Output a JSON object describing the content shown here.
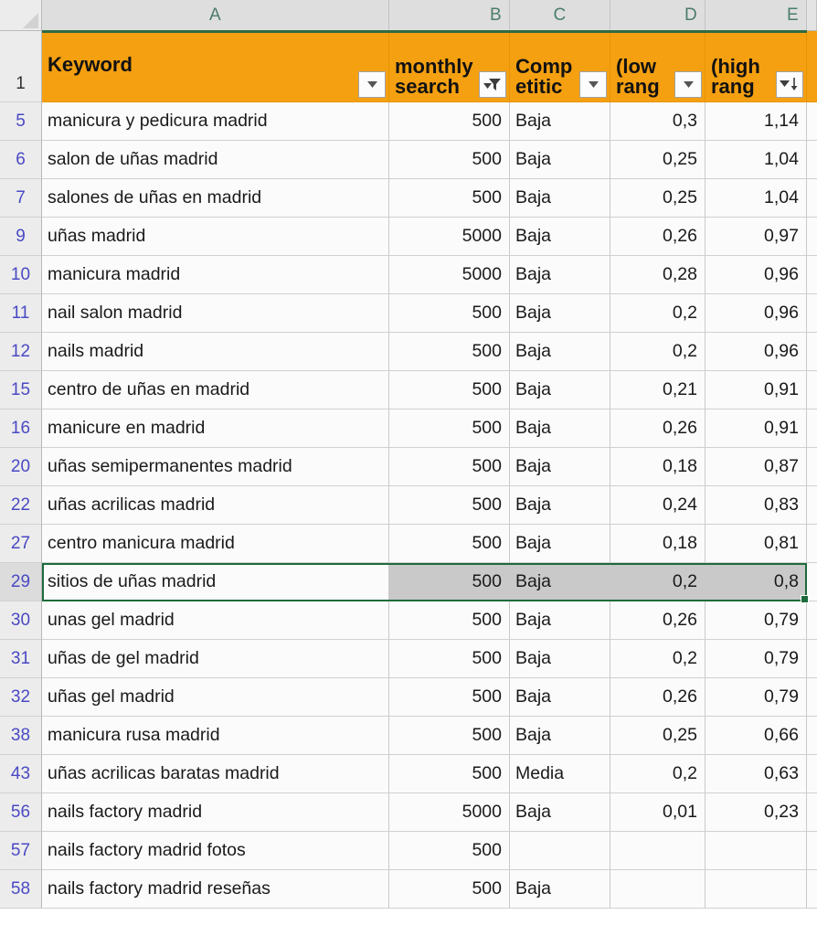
{
  "app": {
    "type": "spreadsheet",
    "accent_orange": "#F5A011",
    "selection_green": "#1D6B3C",
    "rowheader_blue": "#4A49C4",
    "colheader_teal": "#4B7D69",
    "selected_fill_gray": "#C9C9C9"
  },
  "column_headers": {
    "corner": "select-all",
    "letters": [
      "A",
      "B",
      "C",
      "D",
      "E"
    ]
  },
  "filter_header": {
    "row_number": "1",
    "cells": [
      {
        "col": "A",
        "text": "Keyword",
        "icon": "filter-dropdown-icon",
        "filtered": false,
        "sorted": "none"
      },
      {
        "col": "B",
        "text": "monthly\nsearch",
        "icon": "filter-applied-icon",
        "filtered": true,
        "sorted": "none"
      },
      {
        "col": "C",
        "text": "Comp\netitic",
        "icon": "filter-dropdown-icon",
        "filtered": false,
        "sorted": "none"
      },
      {
        "col": "D",
        "text": "(low\nrang",
        "icon": "filter-dropdown-icon",
        "filtered": false,
        "sorted": "none"
      },
      {
        "col": "E",
        "text": "(high\nrang",
        "icon": "sort-descending-icon",
        "filtered": false,
        "sorted": "descending"
      }
    ]
  },
  "selection": {
    "active_cell_row": "29",
    "active_cell_text": "sitios de uñas madrid",
    "range": "A29:E29",
    "fill_handle": true
  },
  "table": {
    "columns": [
      "Keyword",
      "monthly search",
      "Competition",
      "(low range)",
      "(high range)"
    ],
    "rows": [
      {
        "n": "5",
        "keyword": "manicura y pedicura madrid",
        "searches": "500",
        "competition": "Baja",
        "low": "0,3",
        "high": "1,14",
        "selected": false
      },
      {
        "n": "6",
        "keyword": "salon de uñas madrid",
        "searches": "500",
        "competition": "Baja",
        "low": "0,25",
        "high": "1,04",
        "selected": false
      },
      {
        "n": "7",
        "keyword": "salones de uñas en madrid",
        "searches": "500",
        "competition": "Baja",
        "low": "0,25",
        "high": "1,04",
        "selected": false
      },
      {
        "n": "9",
        "keyword": "uñas madrid",
        "searches": "5000",
        "competition": "Baja",
        "low": "0,26",
        "high": "0,97",
        "selected": false
      },
      {
        "n": "10",
        "keyword": "manicura madrid",
        "searches": "5000",
        "competition": "Baja",
        "low": "0,28",
        "high": "0,96",
        "selected": false
      },
      {
        "n": "11",
        "keyword": "nail salon madrid",
        "searches": "500",
        "competition": "Baja",
        "low": "0,2",
        "high": "0,96",
        "selected": false
      },
      {
        "n": "12",
        "keyword": "nails madrid",
        "searches": "500",
        "competition": "Baja",
        "low": "0,2",
        "high": "0,96",
        "selected": false
      },
      {
        "n": "15",
        "keyword": "centro de uñas en madrid",
        "searches": "500",
        "competition": "Baja",
        "low": "0,21",
        "high": "0,91",
        "selected": false
      },
      {
        "n": "16",
        "keyword": "manicure en madrid",
        "searches": "500",
        "competition": "Baja",
        "low": "0,26",
        "high": "0,91",
        "selected": false
      },
      {
        "n": "20",
        "keyword": "uñas semipermanentes madrid",
        "searches": "500",
        "competition": "Baja",
        "low": "0,18",
        "high": "0,87",
        "selected": false
      },
      {
        "n": "22",
        "keyword": "uñas acrilicas madrid",
        "searches": "500",
        "competition": "Baja",
        "low": "0,24",
        "high": "0,83",
        "selected": false
      },
      {
        "n": "27",
        "keyword": "centro manicura madrid",
        "searches": "500",
        "competition": "Baja",
        "low": "0,18",
        "high": "0,81",
        "selected": false
      },
      {
        "n": "29",
        "keyword": "sitios de uñas madrid",
        "searches": "500",
        "competition": "Baja",
        "low": "0,2",
        "high": "0,8",
        "selected": true
      },
      {
        "n": "30",
        "keyword": "unas gel madrid",
        "searches": "500",
        "competition": "Baja",
        "low": "0,26",
        "high": "0,79",
        "selected": false
      },
      {
        "n": "31",
        "keyword": "uñas de gel madrid",
        "searches": "500",
        "competition": "Baja",
        "low": "0,2",
        "high": "0,79",
        "selected": false
      },
      {
        "n": "32",
        "keyword": "uñas gel madrid",
        "searches": "500",
        "competition": "Baja",
        "low": "0,26",
        "high": "0,79",
        "selected": false
      },
      {
        "n": "38",
        "keyword": "manicura rusa madrid",
        "searches": "500",
        "competition": "Baja",
        "low": "0,25",
        "high": "0,66",
        "selected": false
      },
      {
        "n": "43",
        "keyword": "uñas acrilicas baratas madrid",
        "searches": "500",
        "competition": "Media",
        "low": "0,2",
        "high": "0,63",
        "selected": false
      },
      {
        "n": "56",
        "keyword": "nails factory madrid",
        "searches": "5000",
        "competition": "Baja",
        "low": "0,01",
        "high": "0,23",
        "selected": false
      },
      {
        "n": "57",
        "keyword": "nails factory madrid fotos",
        "searches": "500",
        "competition": "",
        "low": "",
        "high": "",
        "selected": false
      },
      {
        "n": "58",
        "keyword": "nails factory madrid reseñas",
        "searches": "500",
        "competition": "Baja",
        "low": "",
        "high": "",
        "selected": false
      }
    ]
  }
}
